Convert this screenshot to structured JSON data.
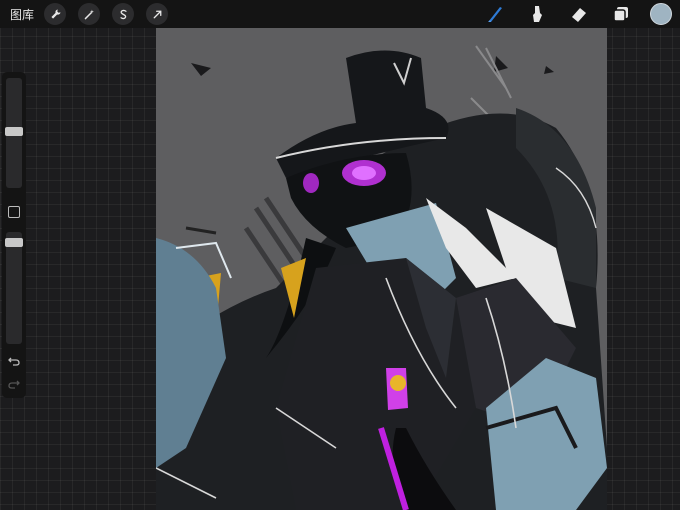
{
  "topbar": {
    "gallery_label": "图库",
    "left_tools": [
      "wrench-icon",
      "magic-wand-icon",
      "selection-s-icon",
      "transform-arrow-icon"
    ],
    "right_tools": [
      "brush-icon",
      "smudge-icon",
      "eraser-icon",
      "layers-icon"
    ],
    "active_tool": "brush-icon",
    "current_color": "#9fb4c2",
    "brush_color": "#2e7bd6"
  },
  "sidebar": {
    "size_slider_label": "brush-size",
    "opacity_slider_label": "brush-opacity",
    "modify_button": "square-modify-icon",
    "undo": "undo-icon",
    "redo": "redo-icon"
  },
  "canvas": {
    "artwork": "plague-doctor-illustration"
  }
}
